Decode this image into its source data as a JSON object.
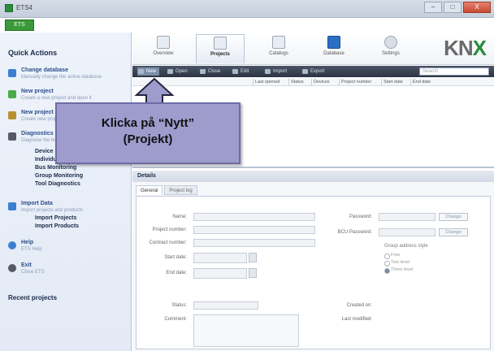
{
  "window": {
    "title": "ETS4",
    "close": "X",
    "minimize": "–",
    "maximize": "□"
  },
  "badge": "ETS",
  "sidebar": {
    "heading": "Quick Actions",
    "items": [
      {
        "label": "Change database",
        "sub": "Manually change the active database",
        "color": "#3b7fd0"
      },
      {
        "label": "New project",
        "sub": "Create a new project and open it",
        "color": "#4caa4c"
      },
      {
        "label": "New project",
        "sub": "Create new project",
        "color": "#b89030"
      },
      {
        "label": "Diagnostics",
        "sub": "Diagnose the bus of an installation",
        "color": "#555b66"
      },
      {
        "label": "Import Data",
        "sub": "Import projects and products",
        "color": "#3b7fd0"
      },
      {
        "label": "Help",
        "sub": "ETS Help",
        "color": "#3b7fd0"
      },
      {
        "label": "Exit",
        "sub": "Close ETS",
        "color": "#555b66"
      }
    ],
    "diag_links": [
      "Device Info",
      "Individual Addresses",
      "Bus Monitoring",
      "Group Monitoring",
      "Tool Diagnostics"
    ],
    "import_links": [
      "Import Projects",
      "Import Products"
    ],
    "recent": "Recent projects"
  },
  "ribbon": {
    "tabs": [
      {
        "label": "Overview",
        "icon": "overview-icon"
      },
      {
        "label": "Projects",
        "icon": "projects-icon",
        "active": true
      },
      {
        "label": "Catalogs",
        "icon": "catalogs-icon"
      },
      {
        "label": "Database",
        "icon": "database-icon"
      },
      {
        "label": "Settings",
        "icon": "gear-icon"
      }
    ],
    "logo": "KN",
    "logo_x": "X"
  },
  "toolbar": {
    "new": "New",
    "open": "Open",
    "close": "Close",
    "edit": "Edit",
    "import": "Import",
    "export": "Export",
    "search_placeholder": "Search"
  },
  "columns": [
    "Last opened",
    "Status",
    "Devices",
    "Project number",
    "Start date",
    "End date"
  ],
  "details": {
    "heading": "Details",
    "tabs": [
      "General",
      "Project log"
    ],
    "fields": {
      "name": "Name:",
      "project_number": "Project number:",
      "contract_number": "Contract number:",
      "start_date": "Start date:",
      "end_date": "End date:",
      "status": "Status:",
      "comment": "Comment:",
      "password": "Password:",
      "bcu_password": "BCU Password:",
      "group_address_style": "Group address style",
      "free": "Free",
      "two_level": "Two level",
      "three_level": "Three level",
      "change_btn": "Change",
      "change_btn2": "Change",
      "created_on": "Created on:",
      "last_modified": "Last modified:"
    }
  },
  "callout": {
    "line1": "Klicka på “Nytt”",
    "line2": "(Projekt)"
  }
}
